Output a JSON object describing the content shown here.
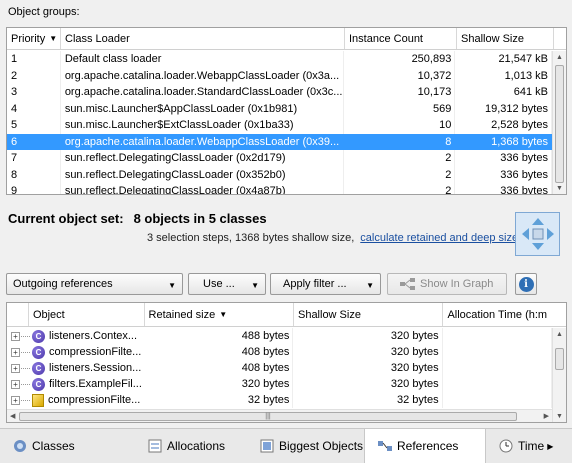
{
  "object_groups_label": "Object groups:",
  "top_table": {
    "columns": [
      "Priority",
      "Class Loader",
      "Instance Count",
      "Shallow Size"
    ],
    "rows": [
      {
        "priority": "1",
        "loader": "Default class loader",
        "count": "250,893",
        "size": "21,547 kB"
      },
      {
        "priority": "2",
        "loader": "org.apache.catalina.loader.WebappClassLoader (0x3a...",
        "count": "10,372",
        "size": "1,013 kB"
      },
      {
        "priority": "3",
        "loader": "org.apache.catalina.loader.StandardClassLoader (0x3c...",
        "count": "10,173",
        "size": "641 kB"
      },
      {
        "priority": "4",
        "loader": "sun.misc.Launcher$AppClassLoader (0x1b981)",
        "count": "569",
        "size": "19,312 bytes"
      },
      {
        "priority": "5",
        "loader": "sun.misc.Launcher$ExtClassLoader (0x1ba33)",
        "count": "10",
        "size": "2,528 bytes"
      },
      {
        "priority": "6",
        "loader": "org.apache.catalina.loader.WebappClassLoader (0x39...",
        "count": "8",
        "size": "1,368 bytes",
        "selected": true
      },
      {
        "priority": "7",
        "loader": "sun.reflect.DelegatingClassLoader (0x2d179)",
        "count": "2",
        "size": "336 bytes"
      },
      {
        "priority": "8",
        "loader": "sun.reflect.DelegatingClassLoader (0x352b0)",
        "count": "2",
        "size": "336 bytes"
      },
      {
        "priority": "9",
        "loader": "sun.reflect.DelegatingClassLoader (0x4a87b)",
        "count": "2",
        "size": "336 bytes"
      }
    ]
  },
  "current_set": {
    "label": "Current object set:",
    "value": "8 objects in 5 classes",
    "description": "3 selection steps,  1368 bytes shallow size,",
    "link": "calculate retained and deep size"
  },
  "toolbar": {
    "references_select": "Outgoing references",
    "use_button": "Use ...",
    "filter_button": "Apply filter ...",
    "graph_button": "Show In Graph",
    "info": "i"
  },
  "bottom_table": {
    "columns": [
      "Object",
      "Retained size",
      "Shallow Size",
      "Allocation Time (h:m"
    ],
    "rows": [
      {
        "name": "listeners.Contex...",
        "retained": "488 bytes",
        "shallow": "320 bytes",
        "icon": "class-icon"
      },
      {
        "name": "compressionFilte...",
        "retained": "408 bytes",
        "shallow": "320 bytes",
        "icon": "class-icon"
      },
      {
        "name": "listeners.Session...",
        "retained": "408 bytes",
        "shallow": "320 bytes",
        "icon": "class-icon"
      },
      {
        "name": "filters.ExampleFil...",
        "retained": "320 bytes",
        "shallow": "320 bytes",
        "icon": "class-icon"
      },
      {
        "name": "compressionFilte...",
        "retained": "32 bytes",
        "shallow": "32 bytes",
        "icon": "object-icon"
      }
    ]
  },
  "tabs": [
    "Classes",
    "Allocations",
    "Biggest Objects",
    "References",
    "Time"
  ],
  "active_tab": "References"
}
